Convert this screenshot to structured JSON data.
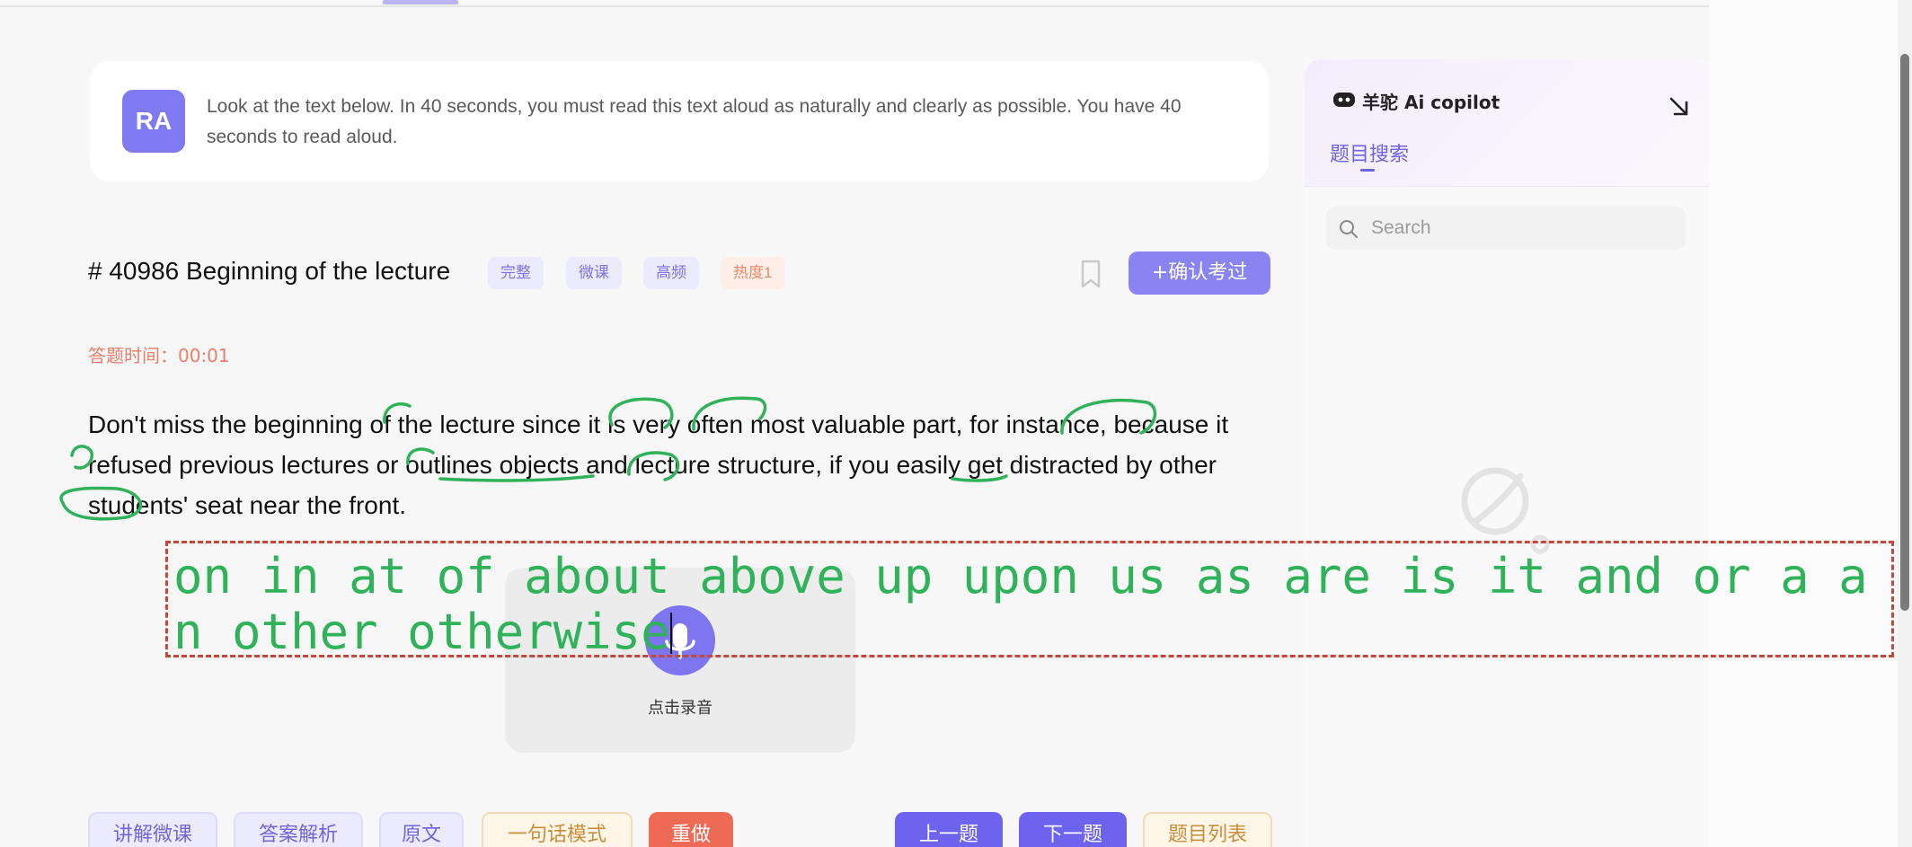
{
  "instruction": {
    "badge": "RA",
    "text": "Look at the text below. In 40 seconds, you must read this text aloud as naturally and clearly as possible. You have 40 seconds to read aloud."
  },
  "question": {
    "title": "# 40986 Beginning of the lecture",
    "tags": [
      "完整",
      "微课",
      "高频",
      "热度1"
    ],
    "confirm_label": "+确认考过",
    "answer_time": "答题时间：00:01",
    "passage": "Don't miss the beginning of the lecture since it is very often most valuable part, for instance, because it refused previous lectures or outlines objects and lecture structure, if you easily get distracted by other students' seat near the front."
  },
  "recorder": {
    "label": "点击录音"
  },
  "overlay_words": "on in at of about above up upon us as are is it and or a an other otherwise",
  "bottom_left_buttons": [
    "讲解微课",
    "答案解析",
    "原文",
    "一句话模式",
    "重做"
  ],
  "bottom_right_buttons": [
    "上一题",
    "下一题",
    "题目列表"
  ],
  "copilot": {
    "title": "羊驼 Ai copilot",
    "tab": "题目搜索",
    "search_placeholder": "Search"
  },
  "icons": {
    "bookmark": "bookmark-icon",
    "microphone": "microphone-icon",
    "bot": "robot-icon",
    "collapse": "arrow-down-right-icon",
    "search": "search-icon",
    "empty": "planet-icon"
  },
  "colors": {
    "accent": "#7f79f2",
    "annotation": "#2fb25a",
    "dashed_box": "#c4473a",
    "answer_time": "#e77f6a",
    "redo": "#ed6a55"
  }
}
